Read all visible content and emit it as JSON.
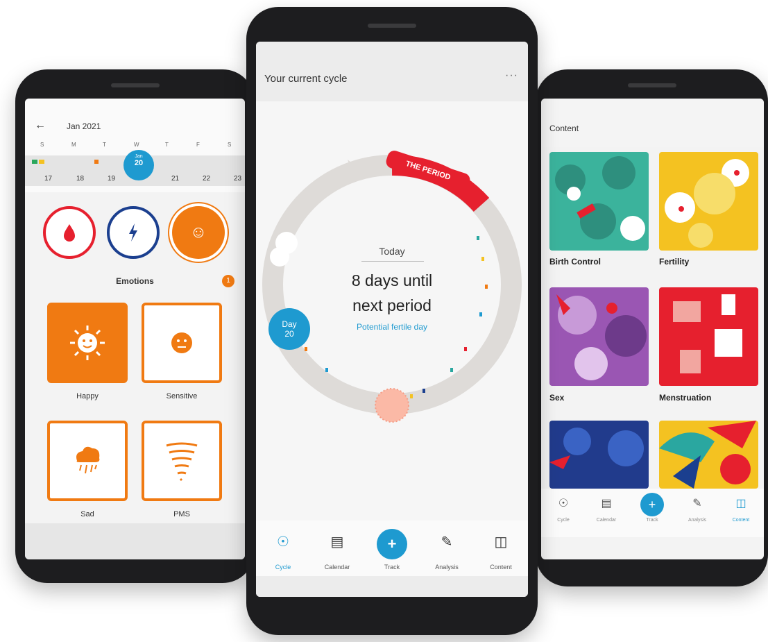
{
  "left_screen": {
    "month": "Jan 2021",
    "back_icon": "arrow-left-icon",
    "weekdays": [
      "S",
      "M",
      "T",
      "W",
      "T",
      "F",
      "S"
    ],
    "days": [
      "17",
      "18",
      "19",
      "20",
      "21",
      "22",
      "23"
    ],
    "today": {
      "label_small": "Jan",
      "day": "20"
    },
    "symptoms": [
      {
        "icon": "blood-drop-icon",
        "color": "#e6202e"
      },
      {
        "icon": "lightning-icon",
        "color": "#1b3f8f"
      },
      {
        "icon": "smiley-icon",
        "color": "#f07a12"
      }
    ],
    "section_title": "Emotions",
    "section_badge": "1",
    "tiles": [
      {
        "label": "Happy",
        "icon": "sun-face-icon",
        "selected": true
      },
      {
        "label": "Sensitive",
        "icon": "face-icon",
        "selected": false
      },
      {
        "label": "Sad",
        "icon": "rain-cloud-icon",
        "selected": false
      },
      {
        "label": "PMS",
        "icon": "tornado-icon",
        "selected": false
      }
    ]
  },
  "center_screen": {
    "title": "Your current cycle",
    "more_icon": "more-horizontal-icon",
    "today_label": "Today",
    "message_line1": "8 days until",
    "message_line2": "next period",
    "fertile_label": "Potential fertile day",
    "period_tag": "THE PERIOD",
    "day_bubble": {
      "label": "Day",
      "value": "20"
    },
    "nav": [
      {
        "label": "Cycle",
        "icon": "cycle-icon",
        "active": true
      },
      {
        "label": "Calendar",
        "icon": "calendar-icon",
        "active": false
      },
      {
        "label": "Track",
        "icon": "plus-icon",
        "active": false
      },
      {
        "label": "Analysis",
        "icon": "analysis-icon",
        "active": false
      },
      {
        "label": "Content",
        "icon": "book-icon",
        "active": false
      }
    ]
  },
  "right_screen": {
    "title": "Content",
    "cards": [
      {
        "label": "Birth Control",
        "bg": "#3bb39c",
        "accent": "#e6202e"
      },
      {
        "label": "Fertility",
        "bg": "#f4c221",
        "accent": "#f7dd6a"
      },
      {
        "label": "Sex",
        "bg": "#9a56b3",
        "accent": "#c89ad8"
      },
      {
        "label": "Menstruation",
        "bg": "#e6202e",
        "accent": "#f2a6a0"
      },
      {
        "label": "",
        "bg": "#213b8c",
        "accent": "#3a63c4"
      },
      {
        "label": "",
        "bg": "#f4c221",
        "accent": "#2aa7a0"
      }
    ],
    "nav": [
      {
        "label": "Cycle",
        "icon": "cycle-icon",
        "active": false
      },
      {
        "label": "Calendar",
        "icon": "calendar-icon",
        "active": false
      },
      {
        "label": "Track",
        "icon": "plus-icon",
        "active": false
      },
      {
        "label": "Analysis",
        "icon": "analysis-icon",
        "active": false
      },
      {
        "label": "Content",
        "icon": "book-icon",
        "active": true
      }
    ]
  },
  "colors": {
    "primary": "#1e9ad0",
    "orange": "#f07a12",
    "red": "#e6202e"
  }
}
